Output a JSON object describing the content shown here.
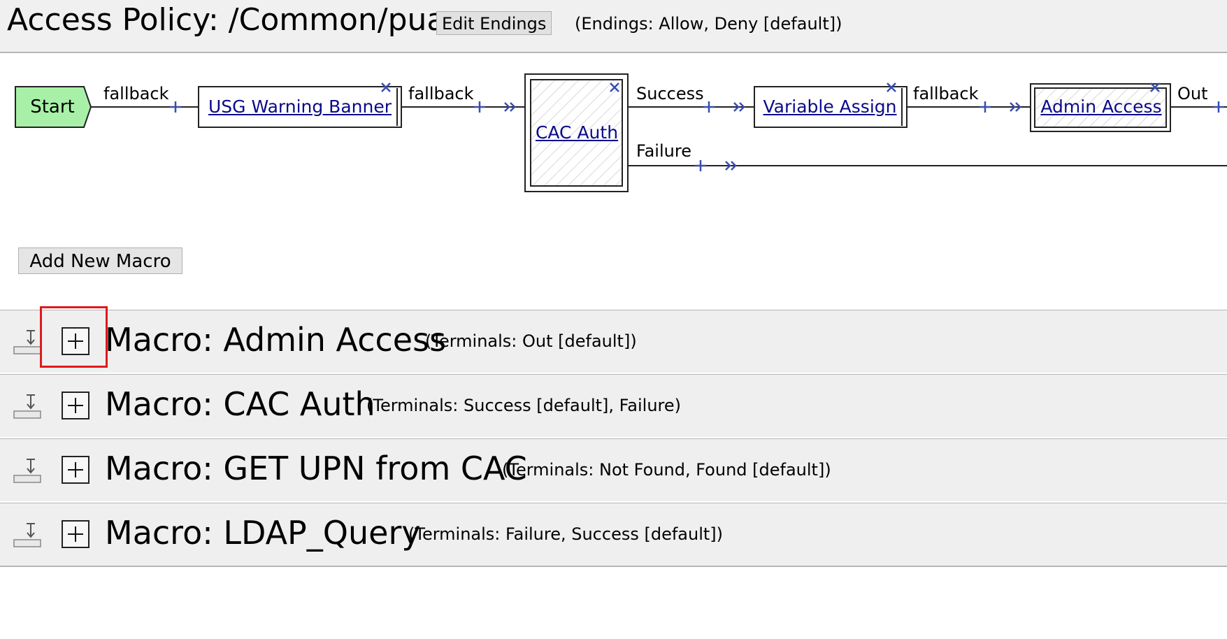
{
  "header": {
    "title": "Access Policy: /Common/pua",
    "edit_endings_label": "Edit Endings",
    "endings_note": "(Endings: Allow, Deny [default])"
  },
  "flow": {
    "start_label": "Start",
    "nodes": [
      {
        "label": "USG Warning Banner"
      },
      {
        "label": "CAC Auth"
      },
      {
        "label": "Variable Assign"
      },
      {
        "label": "Admin Access"
      }
    ],
    "branch_labels": {
      "start_out": "fallback",
      "banner_out": "fallback",
      "cac_success": "Success",
      "cac_failure": "Failure",
      "variable_out": "fallback",
      "admin_out": "Out"
    }
  },
  "add_macro_label": "Add New Macro",
  "macros": [
    {
      "title": "Macro: Admin Access",
      "terminals": "(Terminals: Out [default])"
    },
    {
      "title": "Macro: CAC Auth",
      "terminals": "(Terminals: Success [default], Failure)"
    },
    {
      "title": "Macro: GET UPN from CAC",
      "terminals": "(Terminals: Not Found, Found [default])"
    },
    {
      "title": "Macro: LDAP_Query",
      "terminals": "(Terminals: Failure, Success [default])"
    }
  ],
  "colors": {
    "start_fill": "#a8f0a8",
    "link": "#0a0a8a",
    "connector_blue": "#3a4db0",
    "highlight": "#e0191c"
  }
}
